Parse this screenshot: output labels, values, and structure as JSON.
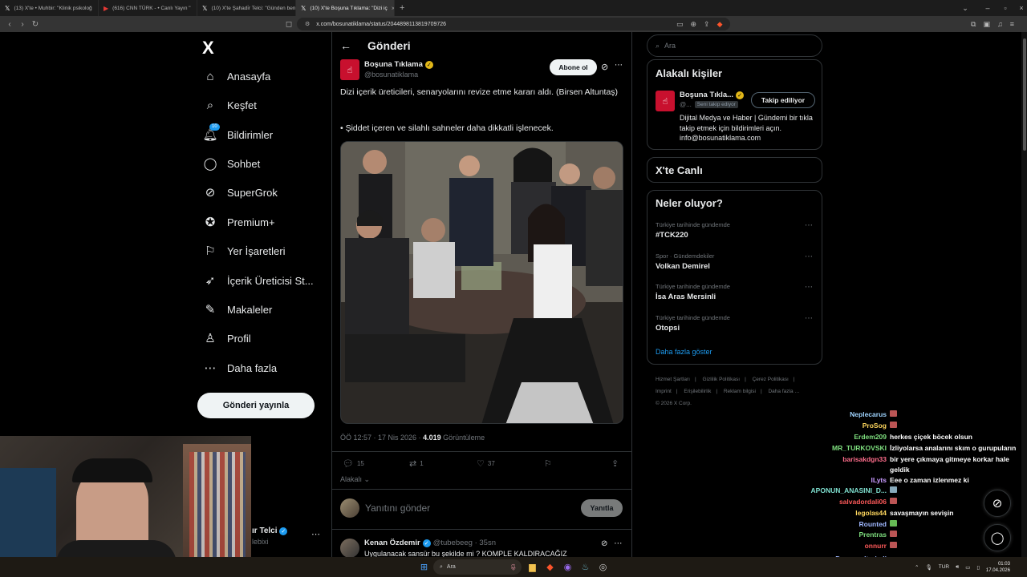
{
  "browser": {
    "tabs": [
      {
        "icon": "x-icon",
        "title": "(13) X'te • Muhbir: \"Klinik psikoloğ"
      },
      {
        "icon": "youtube-icon",
        "title": "(616) CNN TÜRK - • Canlı Yayın \""
      },
      {
        "icon": "x-icon",
        "title": "(10) X'te Şahadi̇r Telci: \"Günden ben"
      },
      {
        "icon": "x-icon",
        "title": "(10) X'te Boşuna Tıklama: \"Dizi iç"
      }
    ],
    "url": "x.com/bosunatiklama/status/2044898113819709726"
  },
  "nav": {
    "logo": "X",
    "items": [
      {
        "label": "Anasayfa",
        "icon": "home-icon"
      },
      {
        "label": "Keşfet",
        "icon": "search-icon"
      },
      {
        "label": "Bildirimler",
        "icon": "bell-icon",
        "badge": "10"
      },
      {
        "label": "Sohbet",
        "icon": "chat-icon"
      },
      {
        "label": "SuperGrok",
        "icon": "grok-icon"
      },
      {
        "label": "Premium+",
        "icon": "premium-icon"
      },
      {
        "label": "Yer İşaretleri",
        "icon": "bookmark-icon"
      },
      {
        "label": "İçerik Üreticisi St...",
        "icon": "rocket-icon"
      },
      {
        "label": "Makaleler",
        "icon": "article-icon"
      },
      {
        "label": "Profil",
        "icon": "profile-icon"
      },
      {
        "label": "Daha fazla",
        "icon": "more-circle-icon"
      }
    ],
    "post_button": "Gönderi yayınla",
    "account": {
      "name": "ır Telci",
      "handle": "lebixi"
    }
  },
  "post": {
    "header": "Gönderi",
    "author": {
      "name": "Boşuna Tıklama",
      "handle": "@bosunatiklama"
    },
    "follow_label": "Abone ol",
    "text1": "Dizi içerik üreticileri, senaryolarını revize etme kararı aldı. (Birsen Altuntaş)",
    "text2": "• Şiddet içeren ve silahlı sahneler daha dikkatli işlenecek.",
    "time": "ÖÖ 12:57 · 17 Nis 2026 · ",
    "views": "4.019",
    "views_label": " Görüntüleme",
    "stats": {
      "replies": "15",
      "reposts": "1",
      "likes": "37"
    },
    "relevant": "Alakalı",
    "reply_placeholder": "Yanıtını gönder",
    "reply_button": "Yanıtla"
  },
  "comment": {
    "name": "Kenan Özdemir",
    "handle": "@tubebeeg · 35sn",
    "text": "Uygulanacak sansür bu şekilde mi ? KOMPLE KALDIRACAĞIZ"
  },
  "sidebar": {
    "search_placeholder": "Ara",
    "relevant_people": {
      "title": "Alakalı kişiler",
      "name": "Boşuna Tıkla...",
      "handle": "@...",
      "follows_you": "Seni takip ediyor",
      "button": "Takip ediliyor",
      "bio": "Dijital Medya ve Haber | Gündemi bir tıkla takip etmek için bildirimleri açın. info@bosunatiklama.com"
    },
    "live_title": "X'te Canlı",
    "trends_title": "Neler oluyor?",
    "trends": [
      {
        "category": "Türkiye tarihinde gündemde",
        "name": "#TCK220"
      },
      {
        "category": "Spor · Gündemdekiler",
        "name": "Volkan Demirel"
      },
      {
        "category": "Türkiye tarihinde gündemde",
        "name": "İsa Aras Mersinli"
      },
      {
        "category": "Türkiye tarihinde gündemde",
        "name": "Otopsi"
      }
    ],
    "show_more": "Daha fazla göster",
    "footer": [
      "Hizmet Şartları",
      "|",
      "Gizlilik Politikası",
      "|",
      "Çerez Politikası",
      "|",
      "Imprint",
      "|",
      "Erişilebilirlik",
      "|",
      "Reklam bilgisi",
      "|",
      "Daha fazla …",
      "© 2026 X Corp."
    ]
  },
  "chat": [
    {
      "user": "Neplecarus",
      "color": "#9fd4ff",
      "msg": "",
      "emoji": true
    },
    {
      "user": "ProSog",
      "color": "#ffd75e",
      "msg": "",
      "emoji": true
    },
    {
      "user": "Erdem209",
      "color": "#7fe07f",
      "msg": "herkes çiçek böcek olsun"
    },
    {
      "user": "MR_TURKOVSKI",
      "color": "#7fe07f",
      "msg": "İzliyolarsa analarını skım o gurupuların"
    },
    {
      "user": "barisakdgn33",
      "color": "#ff6e8c",
      "msg": "bir yere çıkmaya gitmeye korkar hale"
    },
    {
      "user": "",
      "color": "#fff",
      "msg": "geldik"
    },
    {
      "user": "ILyts",
      "color": "#c99bff",
      "msg": "Eee o zaman izlenmez ki"
    },
    {
      "user": "APONUN_ANASINI_D...",
      "color": "#7fe0d0",
      "msg": "",
      "emoji": true
    },
    {
      "user": "salvadordali06",
      "color": "#ff5a5a",
      "msg": "",
      "emoji": true
    },
    {
      "user": "legolas44",
      "color": "#ffd75e",
      "msg": "savaşmayın sevişin"
    },
    {
      "user": "Rounted",
      "color": "#9fb8ff",
      "msg": "",
      "emoji": true
    },
    {
      "user": "Prentras",
      "color": "#7fe07f",
      "msg": "",
      "emoji": true
    },
    {
      "user": "onnurr",
      "color": "#ff5a5a",
      "msg": "",
      "emoji": true
    },
    {
      "user": "Duygusaltrajedi",
      "color": "#9fb8ff",
      "msg": ""
    }
  ],
  "taskbar": {
    "search": "Ara",
    "lang": "TUR",
    "time": "01:03",
    "date": "17.04.2026"
  },
  "colors": {
    "accent": "#1d9bf0",
    "verified_gold": "#e2b719",
    "brand_red": "#c8102e"
  }
}
